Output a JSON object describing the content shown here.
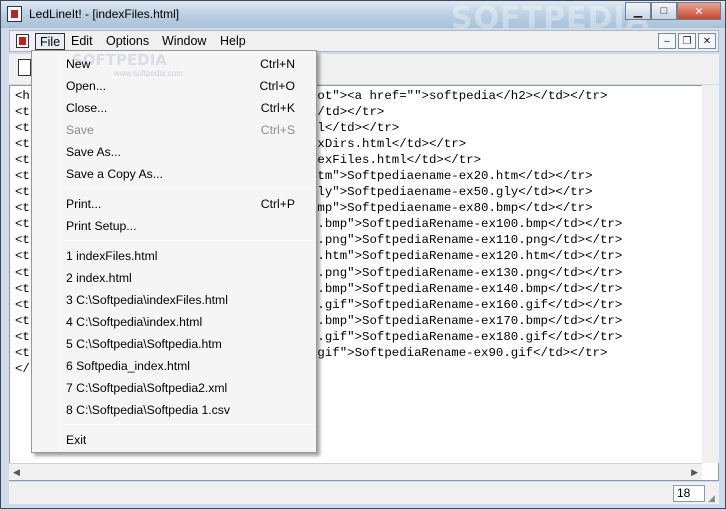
{
  "window": {
    "title": "LedLineIt! - [indexFiles.html]",
    "watermark": "SOFTPEDIA",
    "buttons": {
      "minimize": "▁",
      "maximize": "□",
      "close": "✕"
    }
  },
  "menubar": {
    "items": [
      {
        "label": "File"
      },
      {
        "label": "Edit"
      },
      {
        "label": "Options"
      },
      {
        "label": "Window"
      },
      {
        "label": "Help"
      }
    ],
    "mdi": {
      "minimize": "–",
      "restore": "❐",
      "close": "✕"
    }
  },
  "editor": {
    "lines": [
      "<h",
      "<t",
      "<t",
      "<t",
      "<t",
      "<t",
      "<t",
      "<t",
      "<t",
      "<t",
      "<t",
      "<t",
      "<t",
      "<t",
      "<t",
      "<t",
      "<t",
      "</"
    ],
    "visible_right": [
      "oot\"><a href=\"\">softpedia</h2></td></tr>",
      "</td></tr>",
      "ml</td></tr>",
      "exDirs.html</td></tr>",
      "dexFiles.html</td></tr>",
      "htm\">Softpediaename-ex20.htm</td></tr>",
      "gly\">Softpediaename-ex50.gly</td></tr>",
      "bmp\">Softpediaename-ex80.bmp</td></tr>",
      "0.bmp\">SoftpediaRename-ex100.bmp</td></tr>",
      "0.png\">SoftpediaRename-ex110.png</td></tr>",
      "0.htm\">SoftpediaRename-ex120.htm</td></tr>",
      "0.png\">SoftpediaRename-ex130.png</td></tr>",
      "0.bmp\">SoftpediaRename-ex140.bmp</td></tr>",
      "0.gif\">SoftpediaRename-ex160.gif</td></tr>",
      "0.bmp\">SoftpediaRename-ex170.bmp</td></tr>",
      "0.gif\">SoftpediaRename-ex180.gif</td></tr>",
      ".gif\">SoftpediaRename-ex90.gif</td></tr>",
      ""
    ]
  },
  "statusbar": {
    "line": "18"
  },
  "file_menu": {
    "watermark": "SOFTPEDIA",
    "watermark_url": "www.softpedia.com",
    "items": [
      {
        "label": "New",
        "shortcut": "Ctrl+N"
      },
      {
        "label": "Open...",
        "shortcut": "Ctrl+O"
      },
      {
        "label": "Close...",
        "shortcut": "Ctrl+K"
      },
      {
        "label": "Save",
        "shortcut": "Ctrl+S"
      },
      {
        "label": "Save As...",
        "shortcut": ""
      },
      {
        "label": "Save a Copy As...",
        "shortcut": ""
      },
      {
        "label": "Print...",
        "shortcut": "Ctrl+P"
      },
      {
        "label": "Print Setup...",
        "shortcut": ""
      },
      {
        "label": "1 indexFiles.html",
        "shortcut": ""
      },
      {
        "label": "2 index.html",
        "shortcut": ""
      },
      {
        "label": "3 C:\\Softpedia\\indexFiles.html",
        "shortcut": ""
      },
      {
        "label": "4 C:\\Softpedia\\index.html",
        "shortcut": ""
      },
      {
        "label": "5 C:\\Softpedia\\Softpedia.htm",
        "shortcut": ""
      },
      {
        "label": "6 Softpedia_index.html",
        "shortcut": ""
      },
      {
        "label": "7 C:\\Softpedia\\Softpedia2.xml",
        "shortcut": ""
      },
      {
        "label": "8 C:\\Softpedia\\Softpedia 1.csv",
        "shortcut": ""
      },
      {
        "label": "Exit",
        "shortcut": ""
      }
    ]
  }
}
